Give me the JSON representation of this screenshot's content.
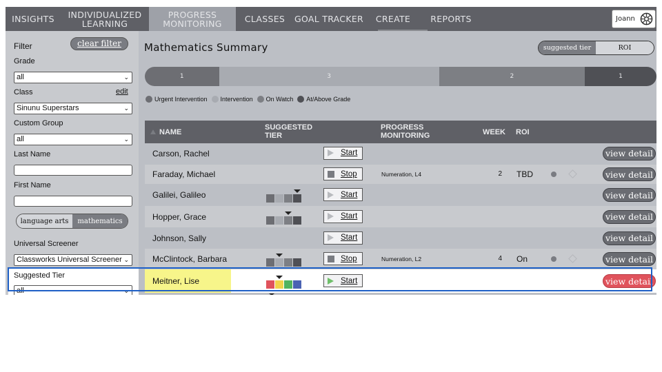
{
  "nav": {
    "items": [
      "INSIGHTS",
      "INDIVIDUALIZED LEARNING",
      "PROGRESS MONITORING",
      "CLASSES",
      "GOAL TRACKER",
      "CREATE",
      "REPORTS"
    ],
    "active_index": 2,
    "user_name": "Joann"
  },
  "sidebar": {
    "filter_label": "Filter",
    "clear_filter_label": "clear filter",
    "grade_label": "Grade",
    "grade_value": "all",
    "class_label": "Class",
    "edit_label": "edit",
    "class_value": "Sinunu Superstars",
    "custom_group_label": "Custom Group",
    "custom_group_value": "all",
    "last_name_label": "Last Name",
    "last_name_value": "",
    "first_name_label": "First Name",
    "first_name_value": "",
    "subject_options": [
      "language arts",
      "mathematics"
    ],
    "subject_selected": "mathematics",
    "universal_screener_label": "Universal Screener",
    "universal_screener_value": "Classworks Universal Screener",
    "suggested_tier_label": "Suggested Tier",
    "suggested_tier_value": "all"
  },
  "main": {
    "title": "Mathematics Summary",
    "view_toggle": {
      "options": [
        "suggested tier",
        "ROI"
      ],
      "selected": "suggested tier"
    }
  },
  "distribution": {
    "segments": [
      {
        "label": "1",
        "share": 0.145,
        "color": "#6d6e73"
      },
      {
        "label": "3",
        "share": 0.43,
        "color": "#a8abb1"
      },
      {
        "label": "2",
        "share": 0.285,
        "color": "#7d7f84"
      },
      {
        "label": "1",
        "share": 0.14,
        "color": "#4f5055"
      }
    ]
  },
  "legend": [
    {
      "label": "Urgent Intervention",
      "color": "#6d6e73"
    },
    {
      "label": "Intervention",
      "color": "#a8abb1"
    },
    {
      "label": "On Watch",
      "color": "#7d7f84"
    },
    {
      "label": "At/Above Grade",
      "color": "#4f5055"
    }
  ],
  "table": {
    "headers": {
      "name": "NAME",
      "suggested_tier": "SUGGESTED TIER",
      "progress": "PROGRESS MONITORING",
      "week": "WEEK",
      "roi": "ROI"
    },
    "rows": [
      {
        "name": "Carson, Rachel",
        "action": "Start",
        "progress": "",
        "week": "",
        "roi": "",
        "tier": null,
        "detail": "view detail"
      },
      {
        "name": "Faraday, Michael",
        "action": "Stop",
        "progress": "Numeration, L4",
        "week": "2",
        "roi": "TBD",
        "tier": null,
        "detail": "view detail"
      },
      {
        "name": "Galilei, Galileo",
        "action": "Start",
        "progress": "",
        "week": "",
        "roi": "",
        "tier": 4,
        "detail": "view detail"
      },
      {
        "name": "Hopper, Grace",
        "action": "Start",
        "progress": "",
        "week": "",
        "roi": "",
        "tier": 3,
        "detail": "view detail"
      },
      {
        "name": "Johnson, Sally",
        "action": "Start",
        "progress": "",
        "week": "",
        "roi": "",
        "tier": null,
        "detail": "view detail"
      },
      {
        "name": "McClintock, Barbara",
        "action": "Stop",
        "progress": "Numeration, L2",
        "week": "4",
        "roi": "On",
        "tier": 2,
        "detail": "view detail"
      },
      {
        "name": "Meitner, Lise",
        "action": "Start",
        "progress": "",
        "week": "",
        "roi": "",
        "tier": 2,
        "detail": "view detail",
        "selected": true
      }
    ]
  },
  "colors": {
    "nav_bg": "#5f6066",
    "tier_urgent": "#e0535c",
    "tier_intervention": "#f2d34a",
    "tier_watch": "#52b35f",
    "tier_above": "#4a62b3",
    "selection_outline": "#1d5fc6"
  }
}
